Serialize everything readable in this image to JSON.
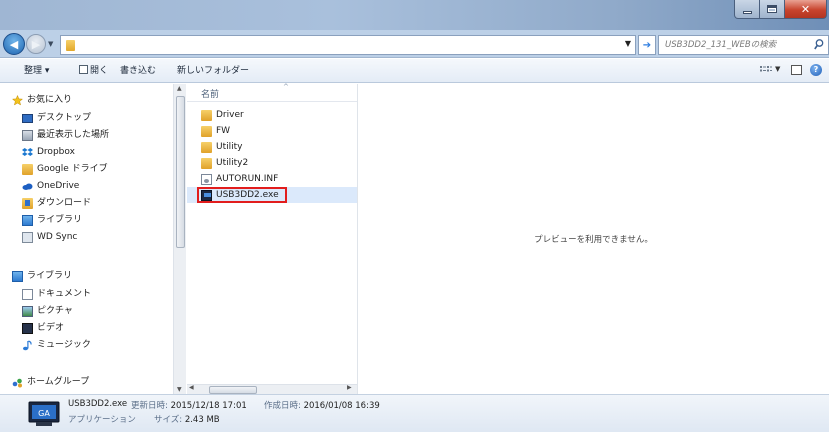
{
  "address": {
    "search_placeholder": "USB3DD2_131_WEBの検索"
  },
  "toolbar": {
    "organize": "整理 ▾",
    "open": "開く",
    "burn": "書き込む",
    "new_folder": "新しいフォルダー"
  },
  "nav": {
    "favorites": {
      "header": "お気に入り",
      "items": [
        "デスクトップ",
        "最近表示した場所",
        "Dropbox",
        "Google ドライブ",
        "OneDrive",
        "ダウンロード",
        "ライブラリ",
        "WD Sync"
      ]
    },
    "libraries": {
      "header": "ライブラリ",
      "items": [
        "ドキュメント",
        "ピクチャ",
        "ビデオ",
        "ミュージック"
      ]
    },
    "homegroup": "ホームグループ"
  },
  "filelist": {
    "column_name": "名前",
    "files": [
      "Driver",
      "FW",
      "Utility",
      "Utility2",
      "AUTORUN.INF",
      "USB3DD2.exe"
    ],
    "selected": "USB3DD2.exe"
  },
  "preview": {
    "message": "プレビューを利用できません。"
  },
  "details": {
    "filename": "USB3DD2.exe",
    "modified_label": "更新日時:",
    "modified_value": "2015/12/18 17:01",
    "created_label": "作成日時:",
    "created_value": "2016/01/08 16:39",
    "type": "アプリケーション",
    "size_label": "サイズ:",
    "size_value": "2.43 MB",
    "icon_text": "GA"
  },
  "colors": {
    "selection_outline": "#e21d1d",
    "selection_fill": "#dbe9fb",
    "folder": "#e8b53a"
  }
}
